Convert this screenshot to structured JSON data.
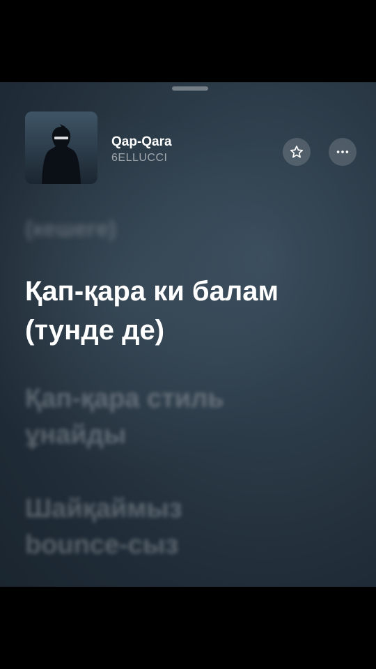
{
  "track": {
    "title": "Qap-Qara",
    "artist": "6ELLUCCI"
  },
  "controls": {
    "favorite_icon": "star-outline-icon",
    "more_icon": "ellipsis-icon"
  },
  "lyrics": {
    "previous": "(кешеге)",
    "current": [
      "Қап-қара ки балам",
      "(тунде де)"
    ],
    "upcoming": [
      [
        "Қап-қара стиль",
        "ұнайды"
      ],
      [
        "Шайқаймыз",
        "bounce-сыз"
      ]
    ]
  },
  "colors": {
    "background": "#263440",
    "text_primary": "#ffffff"
  }
}
